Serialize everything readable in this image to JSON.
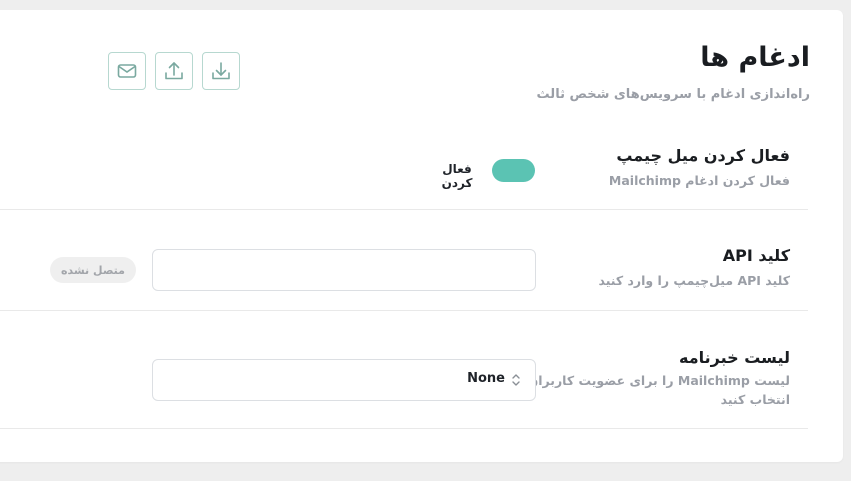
{
  "header": {
    "title": "ادغام ها",
    "subtitle": "راه‌اندازی ادغام با سرویس‌های شخص ثالث"
  },
  "toolbar": {
    "icons": [
      "mail-icon",
      "upload-icon",
      "download-icon"
    ]
  },
  "sections": {
    "enable": {
      "title": "فعال کردن میل چیمپ",
      "description": "فعال کردن ادغام Mailchimp",
      "toggle_label": "فعال کردن",
      "toggle_on": true
    },
    "api_key": {
      "title": "کلید API",
      "description": "کلید API میل‌چیمپ را وارد کنید",
      "input_value": "",
      "status_badge": "متصل نشده"
    },
    "newsletter": {
      "title": "لیست خبرنامه",
      "description_line1": "لیست Mailchimp را برای عضویت کاربران",
      "description_line2": "انتخاب کنید",
      "selected_value": "None"
    }
  },
  "colors": {
    "accent": "#5bc3b3",
    "icon_border": "#b7d8d0",
    "icon_color": "#7aa9a0",
    "muted_text": "#9a9ea6"
  }
}
